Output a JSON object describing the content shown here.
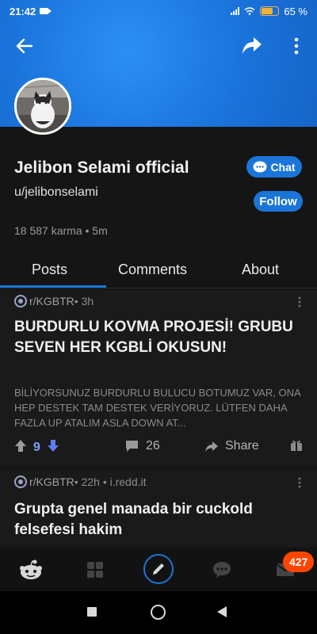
{
  "status_bar": {
    "time": "21:42",
    "battery": "65 %"
  },
  "profile": {
    "display_name": "Jelibon Selami official",
    "username": "u/jelibonselami",
    "meta": "18 587 karma • 5m",
    "chat_label": "Chat",
    "follow_label": "Follow"
  },
  "tabs": [
    {
      "label": "Posts",
      "selected": true
    },
    {
      "label": "Comments"
    },
    {
      "label": "About"
    }
  ],
  "posts": [
    {
      "subreddit": "r/KGBTR",
      "meta": " • 3h",
      "title": "BURDURLU KOVMA PROJESİ! GRUBU SEVEN HER KGBLİ OKUSUN!",
      "body": "BİLİYORSUNUZ BURDURLU BULUCU BOTUMUZ VAR, ONA HEP DESTEK TAM DESTEK VERİYORUZ. LÜTFEN DAHA FAZLA UP ATALIM ASLA DOWN AT...",
      "votes": "9",
      "comments": "26",
      "share_label": "Share"
    },
    {
      "subreddit": "r/KGBTR",
      "meta": " • 22h • i.redd.it",
      "title": "Grupta genel manada bir cuckold felsefesi hakim"
    }
  ],
  "bottom_nav": {
    "inbox_badge": "427"
  },
  "colors": {
    "accent": "#1a75d8",
    "banner": "#1f7ce6",
    "badge": "#ff4500",
    "upvote_count": "#7da1ff"
  },
  "icons": [
    "back-arrow-icon",
    "share-icon",
    "more-vertical-icon",
    "chat-bubble-icon",
    "subreddit-icon",
    "upvote-icon",
    "downvote-icon",
    "comment-icon",
    "reward-icon",
    "home-icon",
    "communities-icon",
    "create-post-icon",
    "chat-icon",
    "inbox-icon"
  ]
}
